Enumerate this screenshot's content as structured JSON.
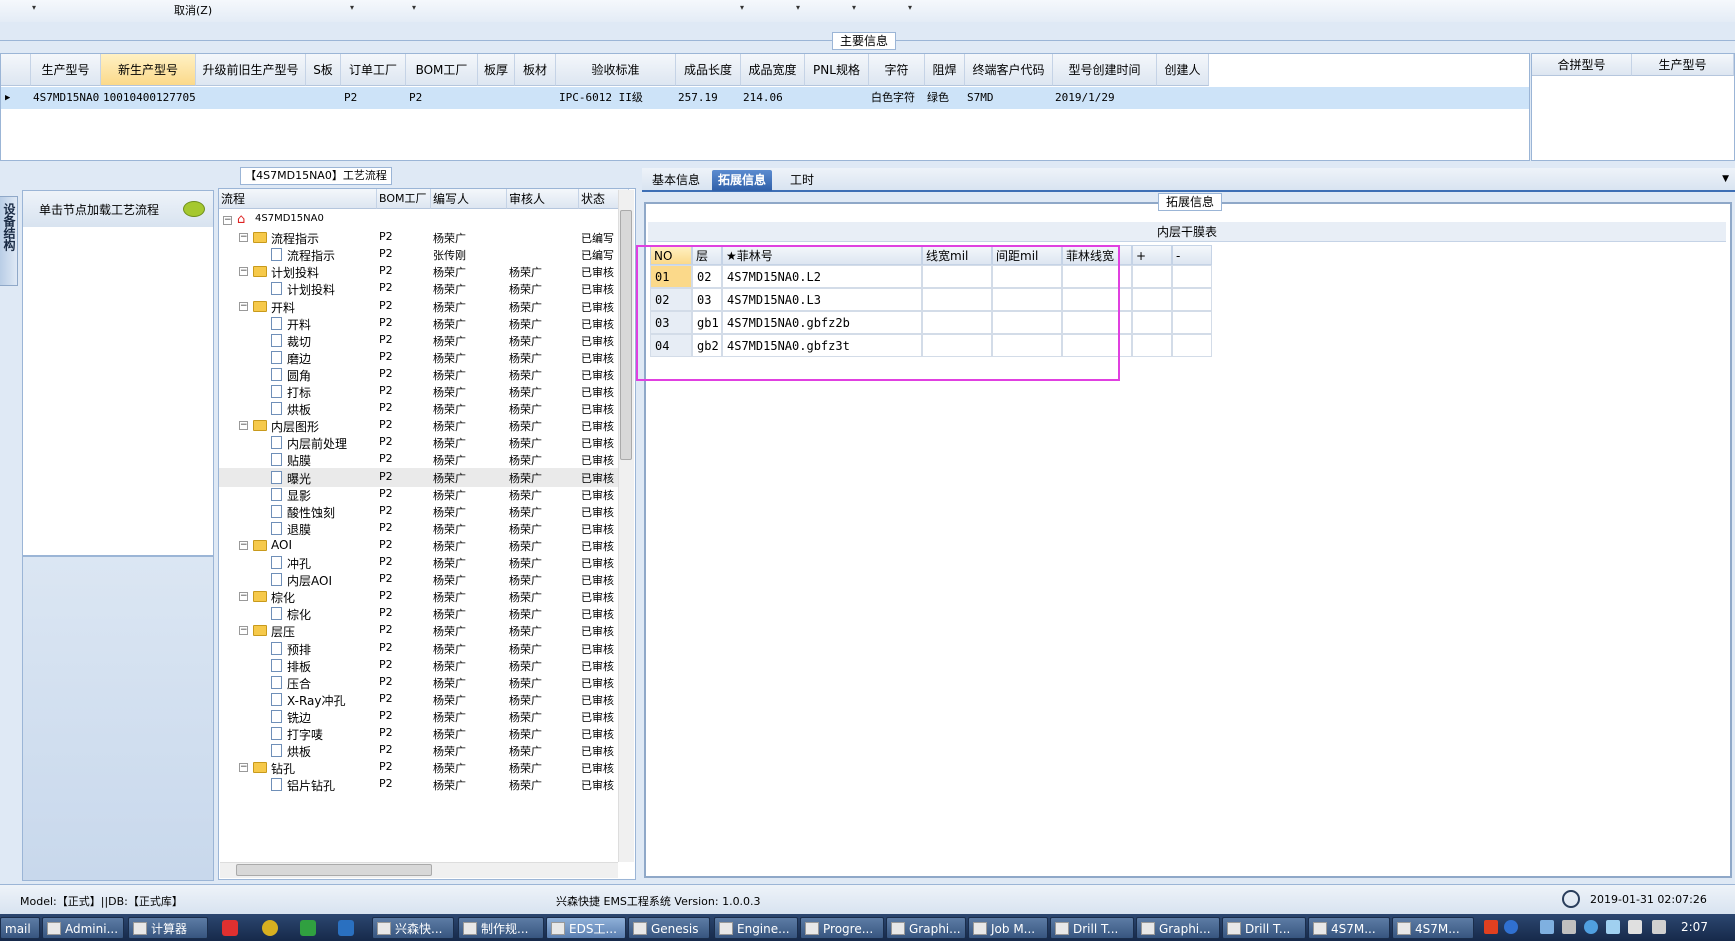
{
  "menu": {
    "cancel": "取消(Z)"
  },
  "main": {
    "section_title": "主要信息",
    "columns": [
      "生产型号",
      "新生产型号",
      "升级前旧生产型号",
      "S板",
      "订单工厂",
      "BOM工厂",
      "板厚",
      "板材",
      "验收标准",
      "成品长度",
      "成品宽度",
      "PNL规格",
      "字符",
      "阻焊",
      "终端客户代码",
      "型号创建时间",
      "创建人"
    ],
    "row": {
      "model": "4S7MD15NA0",
      "new_model": "10010400127705",
      "order_factory": "P2",
      "bom_factory": "P2",
      "standard": "IPC-6012 II级",
      "length": "257.19",
      "width": "214.06",
      "char": "白色字符",
      "solder_mask": "绿色",
      "customer": "S7MD",
      "created": "2019/1/29"
    },
    "right_columns": [
      "合拼型号",
      "生产型号"
    ]
  },
  "left": {
    "vtab": "设备结构",
    "hint": "单击节点加载工艺流程"
  },
  "tree": {
    "caption": "【4S7MD15NA0】工艺流程",
    "columns": [
      "流程",
      "BOM工厂",
      "编写人",
      "审核人",
      "状态"
    ],
    "rows": [
      {
        "name": "4S7MD15NA0",
        "level": 0,
        "bom": "",
        "writer": "",
        "reviewer": "",
        "status": ""
      },
      {
        "name": "流程指示",
        "level": 1,
        "bom": "P2",
        "writer": "杨荣广",
        "reviewer": "",
        "status": "已编写"
      },
      {
        "name": "流程指示",
        "level": 2,
        "bom": "P2",
        "writer": "张传刚",
        "reviewer": "",
        "status": "已编写"
      },
      {
        "name": "计划投料",
        "level": 1,
        "bom": "P2",
        "writer": "杨荣广",
        "reviewer": "杨荣广",
        "status": "已审核"
      },
      {
        "name": "计划投料",
        "level": 2,
        "bom": "P2",
        "writer": "杨荣广",
        "reviewer": "杨荣广",
        "status": "已审核"
      },
      {
        "name": "开料",
        "level": 1,
        "bom": "P2",
        "writer": "杨荣广",
        "reviewer": "杨荣广",
        "status": "已审核"
      },
      {
        "name": "开料",
        "level": 2,
        "bom": "P2",
        "writer": "杨荣广",
        "reviewer": "杨荣广",
        "status": "已审核"
      },
      {
        "name": "裁切",
        "level": 2,
        "bom": "P2",
        "writer": "杨荣广",
        "reviewer": "杨荣广",
        "status": "已审核"
      },
      {
        "name": "磨边",
        "level": 2,
        "bom": "P2",
        "writer": "杨荣广",
        "reviewer": "杨荣广",
        "status": "已审核"
      },
      {
        "name": "圆角",
        "level": 2,
        "bom": "P2",
        "writer": "杨荣广",
        "reviewer": "杨荣广",
        "status": "已审核"
      },
      {
        "name": "打标",
        "level": 2,
        "bom": "P2",
        "writer": "杨荣广",
        "reviewer": "杨荣广",
        "status": "已审核"
      },
      {
        "name": "烘板",
        "level": 2,
        "bom": "P2",
        "writer": "杨荣广",
        "reviewer": "杨荣广",
        "status": "已审核"
      },
      {
        "name": "内层图形",
        "level": 1,
        "bom": "P2",
        "writer": "杨荣广",
        "reviewer": "杨荣广",
        "status": "已审核"
      },
      {
        "name": "内层前处理",
        "level": 2,
        "bom": "P2",
        "writer": "杨荣广",
        "reviewer": "杨荣广",
        "status": "已审核"
      },
      {
        "name": "贴膜",
        "level": 2,
        "bom": "P2",
        "writer": "杨荣广",
        "reviewer": "杨荣广",
        "status": "已审核"
      },
      {
        "name": "曝光",
        "level": 2,
        "bom": "P2",
        "writer": "杨荣广",
        "reviewer": "杨荣广",
        "status": "已审核",
        "selected": true
      },
      {
        "name": "显影",
        "level": 2,
        "bom": "P2",
        "writer": "杨荣广",
        "reviewer": "杨荣广",
        "status": "已审核"
      },
      {
        "name": "酸性蚀刻",
        "level": 2,
        "bom": "P2",
        "writer": "杨荣广",
        "reviewer": "杨荣广",
        "status": "已审核"
      },
      {
        "name": "退膜",
        "level": 2,
        "bom": "P2",
        "writer": "杨荣广",
        "reviewer": "杨荣广",
        "status": "已审核"
      },
      {
        "name": "AOI",
        "level": 1,
        "bom": "P2",
        "writer": "杨荣广",
        "reviewer": "杨荣广",
        "status": "已审核"
      },
      {
        "name": "冲孔",
        "level": 2,
        "bom": "P2",
        "writer": "杨荣广",
        "reviewer": "杨荣广",
        "status": "已审核"
      },
      {
        "name": "内层AOI",
        "level": 2,
        "bom": "P2",
        "writer": "杨荣广",
        "reviewer": "杨荣广",
        "status": "已审核"
      },
      {
        "name": "棕化",
        "level": 1,
        "bom": "P2",
        "writer": "杨荣广",
        "reviewer": "杨荣广",
        "status": "已审核"
      },
      {
        "name": "棕化",
        "level": 2,
        "bom": "P2",
        "writer": "杨荣广",
        "reviewer": "杨荣广",
        "status": "已审核"
      },
      {
        "name": "层压",
        "level": 1,
        "bom": "P2",
        "writer": "杨荣广",
        "reviewer": "杨荣广",
        "status": "已审核"
      },
      {
        "name": "预排",
        "level": 2,
        "bom": "P2",
        "writer": "杨荣广",
        "reviewer": "杨荣广",
        "status": "已审核"
      },
      {
        "name": "排板",
        "level": 2,
        "bom": "P2",
        "writer": "杨荣广",
        "reviewer": "杨荣广",
        "status": "已审核"
      },
      {
        "name": "压合",
        "level": 2,
        "bom": "P2",
        "writer": "杨荣广",
        "reviewer": "杨荣广",
        "status": "已审核"
      },
      {
        "name": "X-Ray冲孔",
        "level": 2,
        "bom": "P2",
        "writer": "杨荣广",
        "reviewer": "杨荣广",
        "status": "已审核"
      },
      {
        "name": "铣边",
        "level": 2,
        "bom": "P2",
        "writer": "杨荣广",
        "reviewer": "杨荣广",
        "status": "已审核"
      },
      {
        "name": "打字唛",
        "level": 2,
        "bom": "P2",
        "writer": "杨荣广",
        "reviewer": "杨荣广",
        "status": "已审核"
      },
      {
        "name": "烘板",
        "level": 2,
        "bom": "P2",
        "writer": "杨荣广",
        "reviewer": "杨荣广",
        "status": "已审核"
      },
      {
        "name": "钻孔",
        "level": 1,
        "bom": "P2",
        "writer": "杨荣广",
        "reviewer": "杨荣广",
        "status": "已审核"
      },
      {
        "name": "铝片钻孔",
        "level": 2,
        "bom": "P2",
        "writer": "杨荣广",
        "reviewer": "杨荣广",
        "status": "已审核"
      }
    ]
  },
  "tabs": [
    "基本信息",
    "拓展信息",
    "工时"
  ],
  "active_tab": 1,
  "ext": {
    "caption": "拓展信息",
    "table_title": "内层干膜表",
    "columns": [
      "NO",
      "层",
      "★菲林号",
      "线宽mil",
      "间距mil",
      "菲林线宽",
      "+",
      "-"
    ],
    "rows": [
      {
        "no": "01",
        "layer": "02",
        "film": "4S7MD15NA0.L2",
        "selected": true
      },
      {
        "no": "02",
        "layer": "03",
        "film": "4S7MD15NA0.L3"
      },
      {
        "no": "03",
        "layer": "gb1",
        "film": "4S7MD15NA0.gbfz2b"
      },
      {
        "no": "04",
        "layer": "gb2",
        "film": "4S7MD15NA0.gbfz3t"
      }
    ]
  },
  "status": {
    "model": "Model:【正式】||DB:【正式库】",
    "system": "兴森快捷 EMS工程系统 Version: 1.0.0.3",
    "datetime": "2019-01-31 02:07:26"
  },
  "taskbar": {
    "items": [
      "mail",
      "Admini...",
      "计算器",
      "",
      "",
      "",
      "",
      "兴森快...",
      "制作规...",
      "EDS工...",
      "Genesis",
      "Engine...",
      "Progre...",
      "Graphi...",
      "Job M...",
      "Drill T...",
      "Graphi...",
      "Drill T...",
      "4S7M...",
      "4S7M..."
    ],
    "time": "2:07"
  },
  "colors": {
    "accent": "#3e6fb5",
    "highlight_box": "#e040e0",
    "selected_row": "#cde3f8",
    "header_highlight": "#fbd98a"
  }
}
